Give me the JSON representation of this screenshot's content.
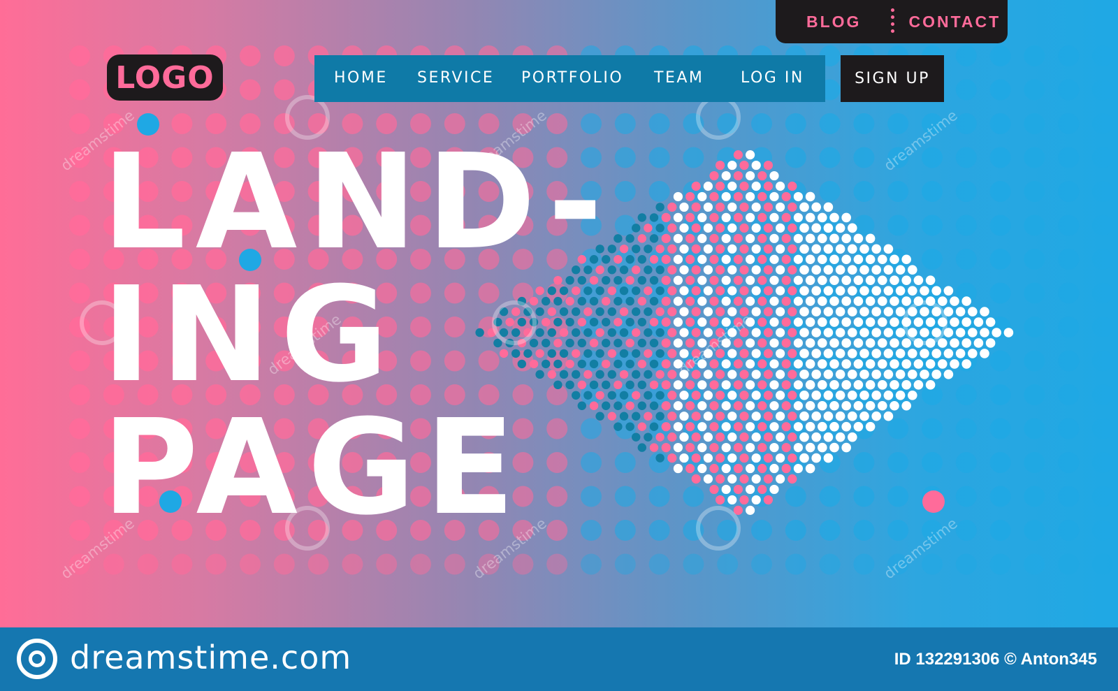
{
  "logo": {
    "text": "LOGO"
  },
  "topbar": {
    "blog": "BLOG",
    "contact": "CONTACT"
  },
  "nav": {
    "items": [
      "HOME",
      "SERVICE",
      "PORTFOLIO",
      "TEAM",
      "LOG IN"
    ],
    "signup": "SIGN UP"
  },
  "hero": {
    "line1": "LAND-",
    "line2": "ING",
    "line3": "PAGE"
  },
  "watermark": {
    "text": "dreamstime"
  },
  "footer": {
    "brand": "dreamstime.com",
    "id_text": "ID 132291306 © Anton345"
  },
  "colors": {
    "pink": "#ff6b9a",
    "blue": "#1fa8e4",
    "dark": "#1d1a1c",
    "nav_teal": "#0f7aa7",
    "footer_blue": "#1577b0",
    "dot_dark_teal": "#127ea3",
    "white": "#ffffff"
  },
  "icons": {
    "footer_logo": "dreamstime-swirl-icon",
    "separator": "dotted-separator-icon"
  }
}
